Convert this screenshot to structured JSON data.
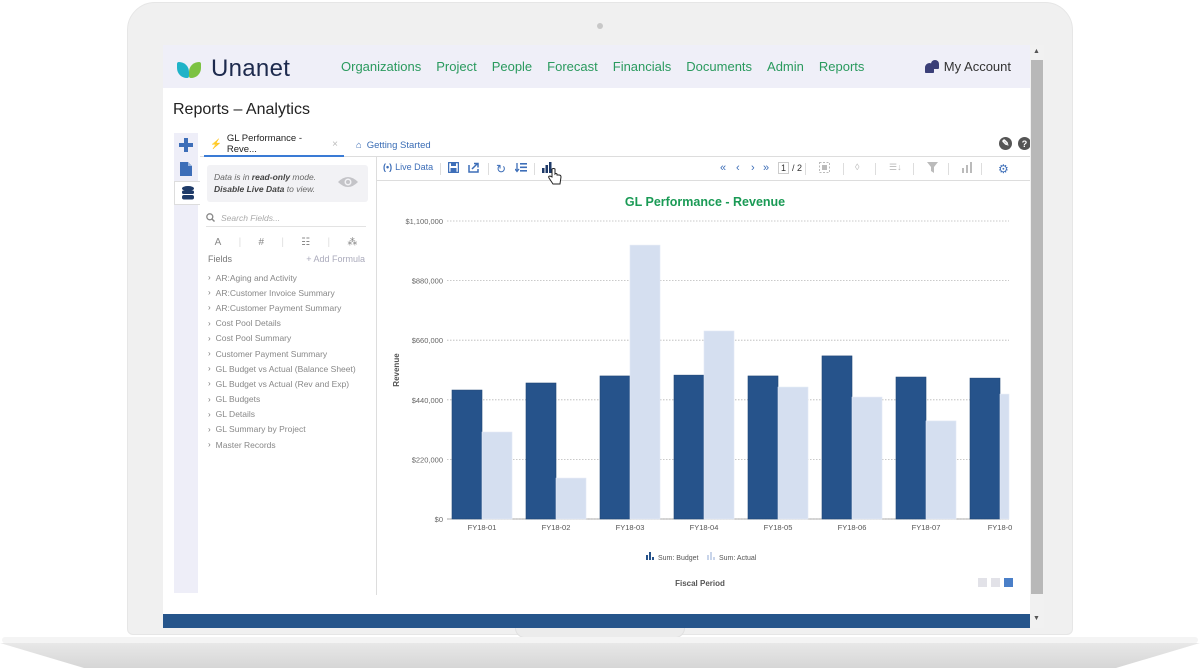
{
  "app": {
    "brand": "Unanet",
    "nav": [
      "Organizations",
      "Project",
      "People",
      "Forecast",
      "Financials",
      "Documents",
      "Admin",
      "Reports"
    ],
    "account_label": "My Account",
    "page_title": "Reports – Analytics"
  },
  "tabs": [
    {
      "label": "GL Performance - Reve...",
      "icon": "lightning-icon",
      "active": true,
      "closable": true
    },
    {
      "label": "Getting Started",
      "icon": "home-icon",
      "active": false
    }
  ],
  "left_rail": [
    "add-icon",
    "document-icon",
    "database-icon"
  ],
  "panel": {
    "notice_line1_pre": "Data is in ",
    "notice_line1_bold": "read-only",
    "notice_line1_post": " mode.",
    "notice_line2_bold": "Disable Live Data",
    "notice_line2_post": " to view.",
    "search_placeholder": "Search Fields...",
    "type_icons": [
      "text-icon",
      "number-icon",
      "table-icon",
      "hierarchy-icon"
    ],
    "fields_label": "Fields",
    "add_formula_label": "+ Add Formula",
    "fields": [
      "AR:Aging and Activity",
      "AR:Customer Invoice Summary",
      "AR:Customer Payment Summary",
      "Cost Pool Details",
      "Cost Pool Summary",
      "Customer Payment Summary",
      "GL Budget vs Actual (Balance Sheet)",
      "GL Budget vs Actual (Rev and Exp)",
      "GL Budgets",
      "GL Details",
      "GL Summary by Project",
      "Master Records"
    ]
  },
  "toolbar": {
    "live_data_label": "Live Data",
    "page_current": "1",
    "page_total": "/ 2"
  },
  "colors": {
    "nav_green": "#2a9a5e",
    "budget": "#26538b",
    "actual": "#d5dff0",
    "title_green": "#1a9a55",
    "footer": "#26558b"
  },
  "chart_data": {
    "type": "bar",
    "title": "GL Performance - Revenue",
    "xlabel": "Fiscal Period",
    "ylabel": "Revenue",
    "ylim": [
      0,
      1100000
    ],
    "yticks": [
      "$0",
      "$220,000",
      "$440,000",
      "$660,000",
      "$880,000",
      "$1,100,000"
    ],
    "ytick_values": [
      0,
      220000,
      440000,
      660000,
      880000,
      1100000
    ],
    "grid": true,
    "legend_position": "bottom",
    "categories": [
      "FY18-01",
      "FY18-02",
      "FY18-03",
      "FY18-04",
      "FY18-05",
      "FY18-06",
      "FY18-07",
      "FY18-0"
    ],
    "series": [
      {
        "name": "Sum: Budget",
        "values": [
          476000,
          502000,
          528000,
          531000,
          528000,
          602000,
          524000,
          520000
        ]
      },
      {
        "name": "Sum: Actual",
        "values": [
          321000,
          151000,
          1011000,
          694000,
          487000,
          450000,
          362000,
          461000
        ]
      }
    ]
  }
}
